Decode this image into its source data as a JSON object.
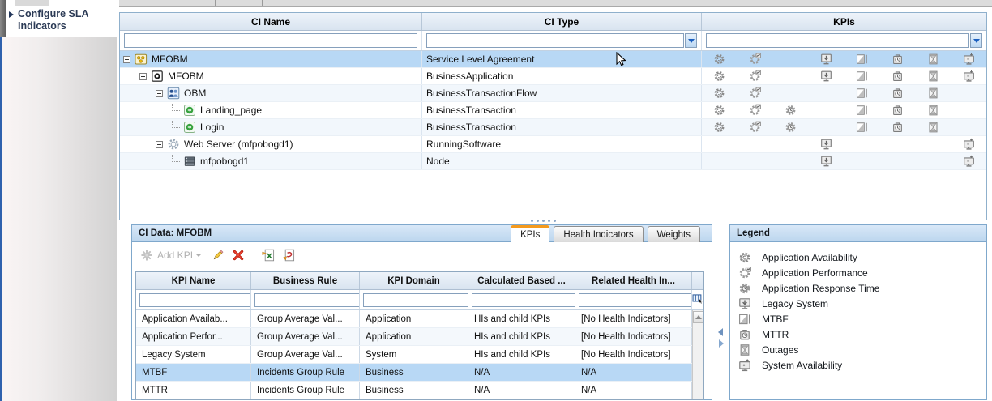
{
  "colors": {
    "selection": "#b8d8f5",
    "tab_accent": "#f59a1d",
    "panel_border": "#7fa8cc"
  },
  "sidebar": {
    "title": "Configure SLA Indicators"
  },
  "tree_panel": {
    "columns": [
      {
        "label": "CI Name"
      },
      {
        "label": "CI Type"
      },
      {
        "label": "KPIs"
      }
    ],
    "filter_values": [
      "",
      "",
      ""
    ],
    "kpi_slot_order": [
      "app-availability",
      "app-performance",
      "app-response-time",
      "legacy-system",
      "mtbf",
      "mttr",
      "outages",
      "system-availability"
    ],
    "rows": [
      {
        "name": "MFOBM",
        "type": "Service Level Agreement",
        "icon": "sla",
        "level": 0,
        "expanded": true,
        "selected": true,
        "kpis": [
          "app-availability",
          "app-performance",
          "legacy-system",
          "mtbf",
          "mttr",
          "outages",
          "system-availability"
        ]
      },
      {
        "name": "MFOBM",
        "type": "BusinessApplication",
        "icon": "business-application",
        "level": 1,
        "expanded": true,
        "kpis": [
          "app-availability",
          "app-performance",
          "legacy-system",
          "mtbf",
          "mttr",
          "outages",
          "system-availability"
        ]
      },
      {
        "name": "OBM",
        "type": "BusinessTransactionFlow",
        "icon": "business-transaction-flow",
        "level": 2,
        "expanded": true,
        "kpis": [
          "app-availability",
          "app-performance",
          "mtbf",
          "mttr",
          "outages"
        ]
      },
      {
        "name": "Landing_page",
        "type": "BusinessTransaction",
        "icon": "business-transaction",
        "level": 3,
        "leaf": true,
        "kpis": [
          "app-availability",
          "app-performance",
          "app-response-time",
          "mtbf",
          "mttr",
          "outages"
        ]
      },
      {
        "name": "Login",
        "type": "BusinessTransaction",
        "icon": "business-transaction",
        "level": 3,
        "leaf": true,
        "kpis": [
          "app-availability",
          "app-performance",
          "app-response-time",
          "mtbf",
          "mttr",
          "outages"
        ]
      },
      {
        "name": "Web Server (mfpobogd1)",
        "type": "RunningSoftware",
        "icon": "running-software",
        "level": 2,
        "expanded": true,
        "kpis": [
          "legacy-system",
          "system-availability"
        ]
      },
      {
        "name": "mfpobogd1",
        "type": "Node",
        "icon": "node",
        "level": 3,
        "leaf": true,
        "kpis": [
          "legacy-system",
          "system-availability"
        ]
      }
    ]
  },
  "ci_data": {
    "title": "CI Data: MFOBM",
    "tabs": [
      {
        "label": "KPIs",
        "active": true
      },
      {
        "label": "Health Indicators",
        "active": false
      },
      {
        "label": "Weights",
        "active": false
      }
    ],
    "toolbar": {
      "add_label": "Add KPI"
    },
    "table": {
      "columns": [
        "KPI Name",
        "Business Rule",
        "KPI Domain",
        "Calculated Based ...",
        "Related Health In..."
      ],
      "filter_values": [
        "",
        "",
        "",
        "",
        ""
      ],
      "rows": [
        [
          "Application Availab...",
          "Group Average Val...",
          "Application",
          "HIs and child KPIs",
          "[No Health Indicators]"
        ],
        [
          "Application Perfor...",
          "Group Average Val...",
          "Application",
          "HIs and child KPIs",
          "[No Health Indicators]"
        ],
        [
          "Legacy System",
          "Group Average Val...",
          "System",
          "HIs and child KPIs",
          "[No Health Indicators]"
        ],
        [
          "MTBF",
          "Incidents Group Rule",
          "Business",
          "N/A",
          "N/A"
        ],
        [
          "MTTR",
          "Incidents Group Rule",
          "Business",
          "N/A",
          "N/A"
        ]
      ],
      "selected_row_index": 3
    }
  },
  "legend": {
    "title": "Legend",
    "items": [
      {
        "icon": "app-availability",
        "label": "Application Availability"
      },
      {
        "icon": "app-performance",
        "label": "Application Performance"
      },
      {
        "icon": "app-response-time",
        "label": "Application Response Time"
      },
      {
        "icon": "legacy-system",
        "label": "Legacy System"
      },
      {
        "icon": "mtbf",
        "label": "MTBF"
      },
      {
        "icon": "mttr",
        "label": "MTTR"
      },
      {
        "icon": "outages",
        "label": "Outages"
      },
      {
        "icon": "system-availability",
        "label": "System Availability"
      }
    ]
  }
}
